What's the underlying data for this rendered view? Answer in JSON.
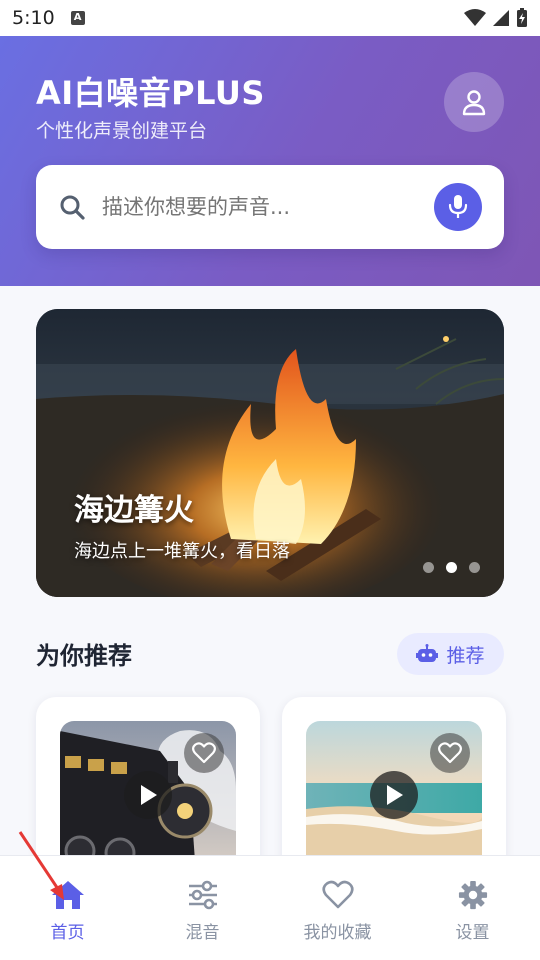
{
  "status_bar": {
    "time": "5:10",
    "notification_icon": "A"
  },
  "header": {
    "title": "AI白噪音PLUS",
    "subtitle": "个性化声景创建平台",
    "avatar_icon": "user-icon"
  },
  "search": {
    "placeholder": "描述你想要的声音...",
    "search_icon": "search-icon",
    "mic_icon": "microphone-icon"
  },
  "banner": {
    "title": "海边篝火",
    "description": "海边点上一堆篝火，看日落",
    "dots_total": 3,
    "active_dot": 2
  },
  "recommend": {
    "title": "为你推荐",
    "pill_label": "推荐",
    "pill_icon": "robot-icon",
    "cards": [
      {
        "image": "steam-train",
        "fav_icon": "heart-icon",
        "play_icon": "play-icon"
      },
      {
        "image": "beach-sunset",
        "fav_icon": "heart-icon",
        "play_icon": "play-icon"
      }
    ]
  },
  "bottom_nav": {
    "items": [
      {
        "label": "首页",
        "icon": "home-icon",
        "active": true
      },
      {
        "label": "混音",
        "icon": "sliders-icon",
        "active": false
      },
      {
        "label": "我的收藏",
        "icon": "heart-icon",
        "active": false
      },
      {
        "label": "设置",
        "icon": "gear-icon",
        "active": false
      }
    ]
  },
  "colors": {
    "accent": "#5b5fe6",
    "header_start": "#6a6fe2",
    "header_end": "#7e56b5",
    "annotation_arrow": "#e53935"
  }
}
